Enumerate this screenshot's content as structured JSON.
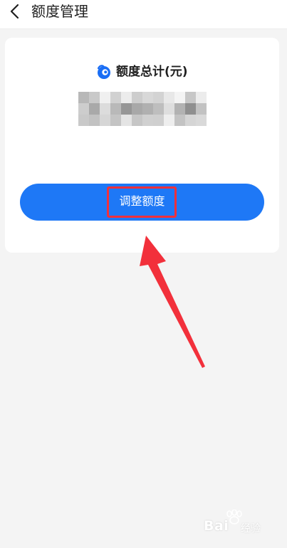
{
  "header": {
    "title": "额度管理",
    "back_icon": "chevron-left-icon"
  },
  "card": {
    "quota_label": "额度总计(元)",
    "logo_icon": "brand-logo-icon",
    "amount_mosaic_colors": [
      "#b8b8b8",
      "#c9c9c9",
      "#f0f0f0",
      "#d1d1d1",
      "#ececec",
      "#cdcdcd",
      "#d8d8d8",
      "#d3d3d3",
      "#e8e8e8",
      "#f4f4f4",
      "#c7c7c7",
      "#ececec",
      "#cdcdcd",
      "#a9a9a9",
      "#dcdcdc",
      "#b9b9b9",
      "#969696",
      "#a8a8a8",
      "#b0b0b0",
      "#bebebe",
      "#dedede",
      "#b2b2b2",
      "#8f8f8f",
      "#c2c2c2",
      "#c9c9c9",
      "#c2c2c2",
      "#d6d6d6",
      "#c4c4c4",
      "#e4e4e4",
      "#c6c6c6",
      "#d0d0d0",
      "#cfcfcf",
      "#eeeeee",
      "#c3c3c3",
      "#d5d5d5",
      "#d9d9d9"
    ],
    "adjust_button_label": "调整额度"
  },
  "colors": {
    "primary_button": "#1e78f6",
    "annotation_red": "#f2303b"
  },
  "watermark": {
    "text": "Bai",
    "sub": "经验",
    "icon": "paw-icon"
  }
}
